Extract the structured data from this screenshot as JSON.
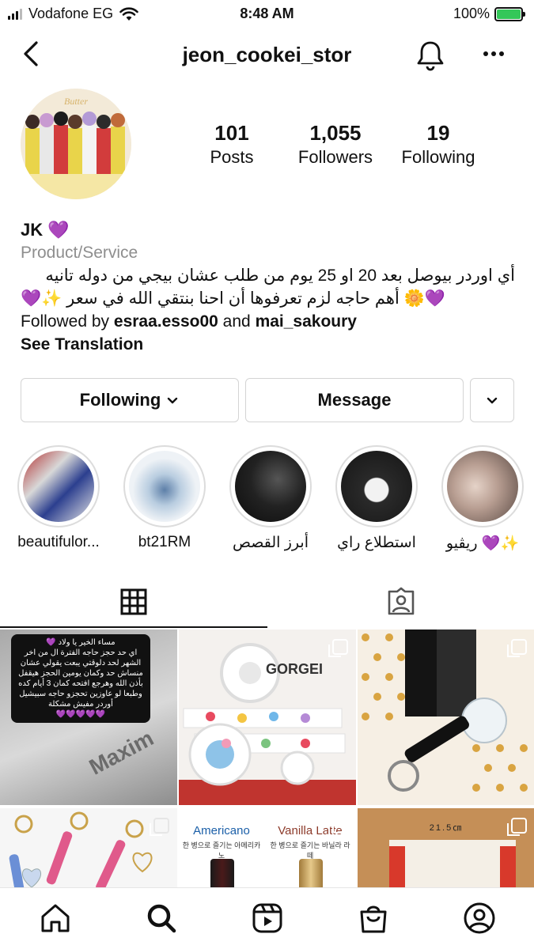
{
  "status_bar": {
    "carrier": "Vodafone EG",
    "time": "8:48 AM",
    "battery": "100%"
  },
  "header": {
    "username": "jeon_cookei_stor"
  },
  "profile": {
    "stats": [
      {
        "value": "101",
        "label": "Posts"
      },
      {
        "value": "1,055",
        "label": "Followers"
      },
      {
        "value": "19",
        "label": "Following"
      }
    ],
    "name": "JK 💜",
    "category": "Product/Service",
    "bio_line1": "أي اوردر بيوصل بعد 20 او 25 يوم من طلب عشان بيجي من دوله تانيه",
    "bio_line2": "💜🌼 أهم حاجه لزم تعرفوها أن احنا بنتقي الله في سعر ✨💜",
    "followed_by_prefix": "Followed by ",
    "followed_by_user1": "esraa.esso00",
    "followed_by_and": " and ",
    "followed_by_user2": "mai_sakoury",
    "see_translation": "See Translation"
  },
  "actions": {
    "following": "Following",
    "message": "Message"
  },
  "highlights": [
    {
      "label": "beautifulor..."
    },
    {
      "label": "bt21RM"
    },
    {
      "label": "أبرز القصص"
    },
    {
      "label": "استطلاع راي"
    },
    {
      "label": "ريڤيو 💜✨"
    }
  ],
  "posts": {
    "post1_text": "مساء الخير يا ولاد 💜\nاي حد حجز حاجه الفترة ال من اخر الشهر لحد دلوقتي يبعت يقولي عشان منساش حد وكمان يومين الحجز هيقفل بأذن الله وهرجع افتحه كمان 3 أيام كده وطبعا لو عاوزين تحجزو حاجه سبيشيل أوردر مفيش مشكلة\n💜💜💜💜💜",
    "post1_brand": "Maxim",
    "post2_text": "GORGEI",
    "post5_left": "Americano",
    "post5_left_sub": "한 병으로 즐기는 아메리카노",
    "post5_right": "Vanilla Latte",
    "post5_right_sub": "한 병으로 즐기는 바닐라 라떼",
    "post6_text": "21.5㎝"
  },
  "colors": {
    "accent_purple": "#8a3ffc",
    "battery_green": "#34c759",
    "muted_text": "#8e8e8e",
    "border": "#d4d4d4"
  }
}
